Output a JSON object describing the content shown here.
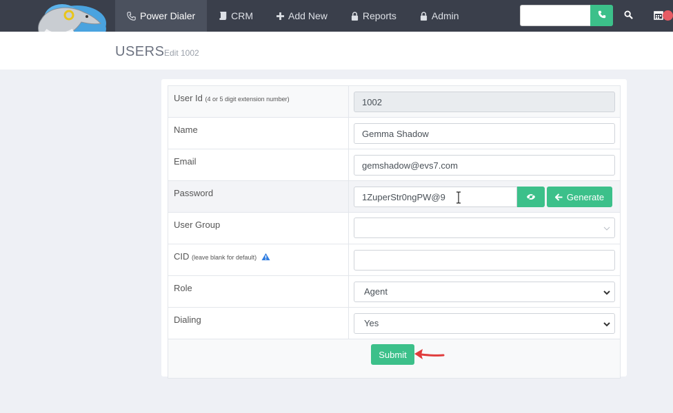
{
  "nav": {
    "items": [
      {
        "label": "Power Dialer",
        "icon": "phone-icon"
      },
      {
        "label": "CRM",
        "icon": "book-icon"
      },
      {
        "label": "Add New",
        "icon": "plus-icon"
      },
      {
        "label": "Reports",
        "icon": "lock-icon"
      },
      {
        "label": "Admin",
        "icon": "lock-icon"
      }
    ],
    "dial_value": "",
    "accent": "#3cc08a"
  },
  "header": {
    "title": "USERS",
    "subtitle": "Edit 1002"
  },
  "form": {
    "user_id_label": "User Id",
    "user_id_hint": "(4 or 5 digit extension number)",
    "user_id_value": "1002",
    "name_label": "Name",
    "name_value": "Gemma Shadow",
    "email_label": "Email",
    "email_value": "gemshadow@evs7.com",
    "password_label": "Password",
    "password_value": "1ZuperStr0ngPW@9",
    "generate_label": "Generate",
    "user_group_label": "User Group",
    "user_group_value": "",
    "cid_label": "CID",
    "cid_hint": "(leave blank for default)",
    "cid_value": "",
    "role_label": "Role",
    "role_value": "Agent",
    "dialing_label": "Dialing",
    "dialing_value": "Yes",
    "submit_label": "Submit"
  }
}
